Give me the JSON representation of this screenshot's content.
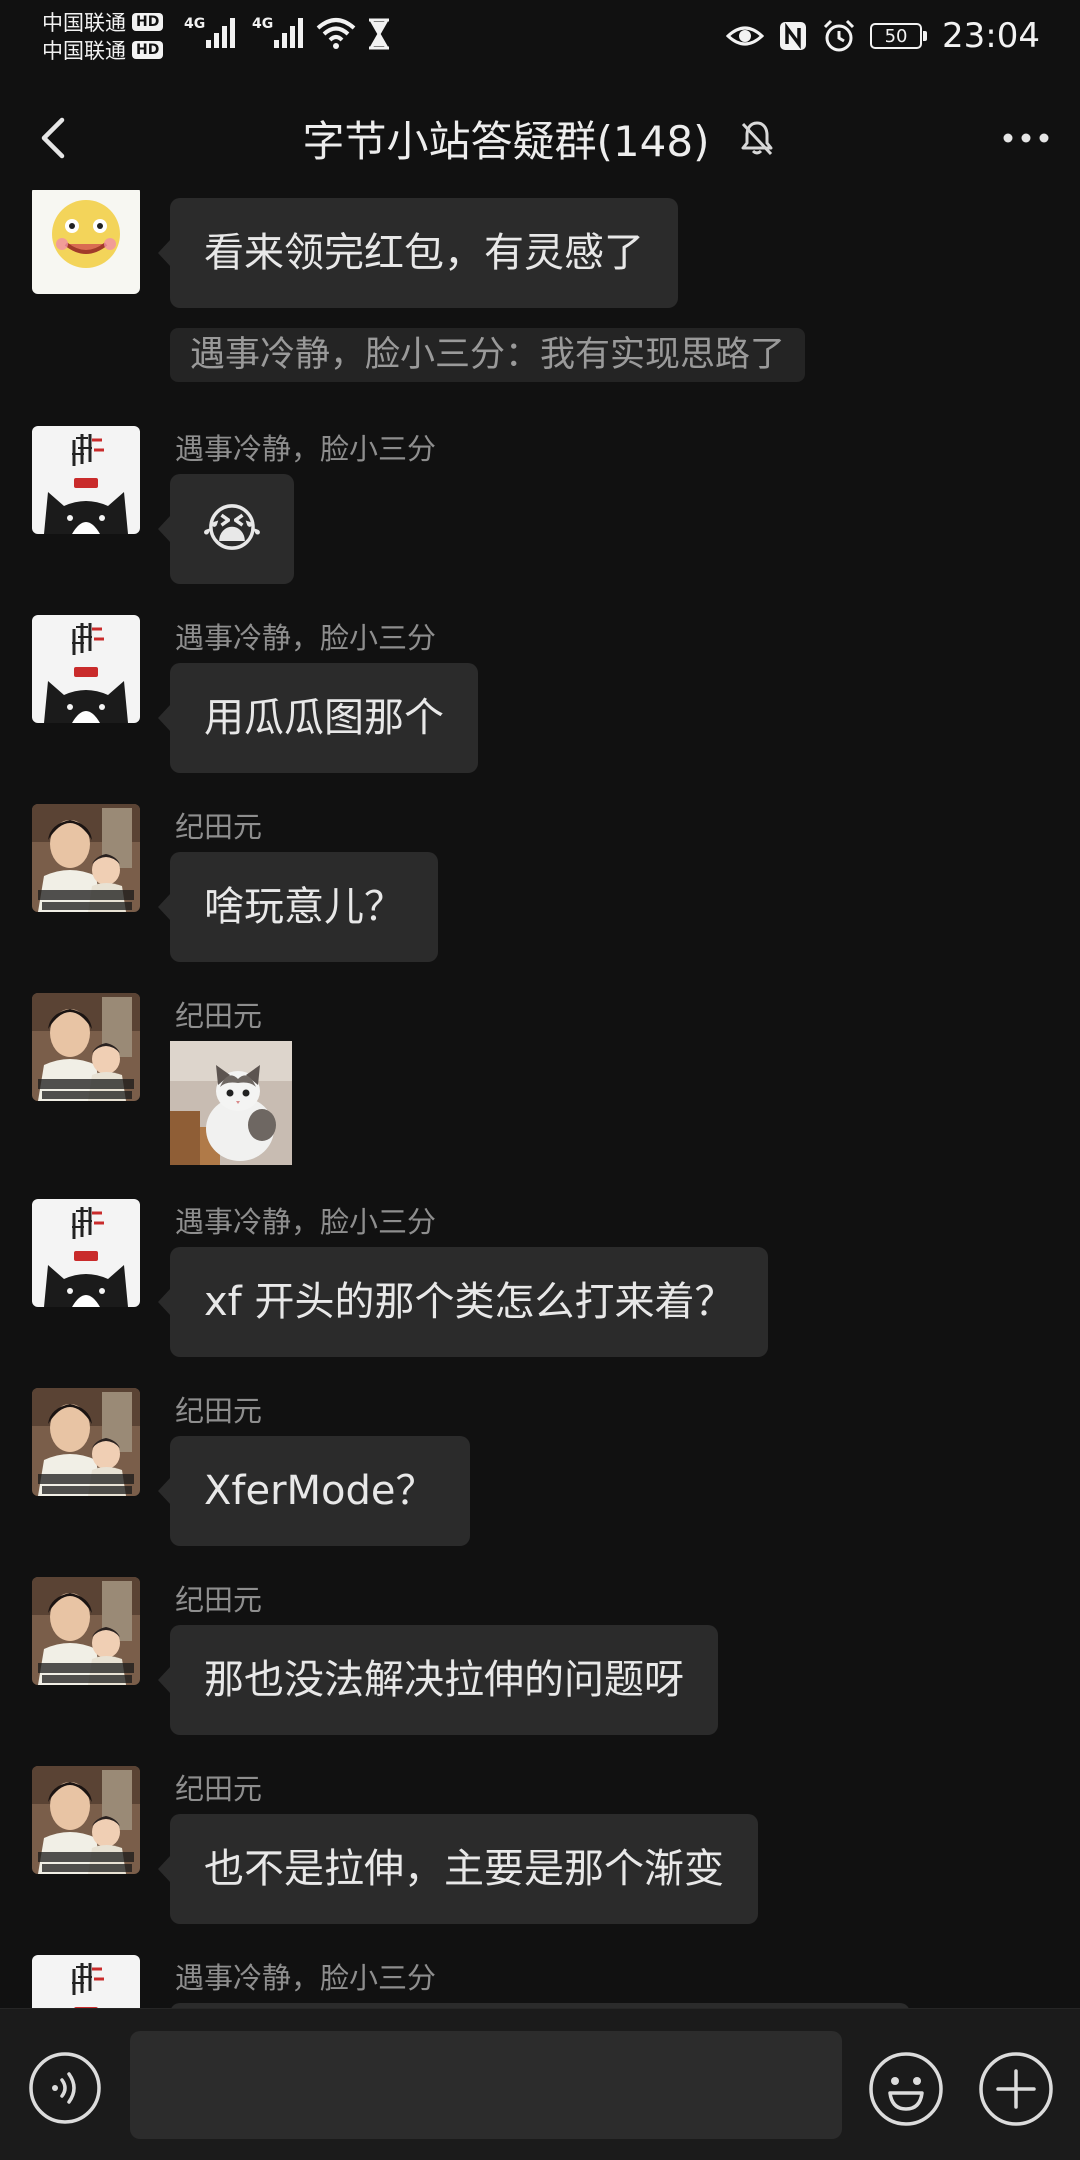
{
  "status_bar": {
    "carrier_1": "中国联通",
    "carrier_2": "中国联通",
    "hd_label": "HD",
    "net_1": "4G",
    "net_2": "4G",
    "battery_level": "50",
    "time": "23:04"
  },
  "header": {
    "title": "字节小站答疑群(148)"
  },
  "messages": [
    {
      "text": "看来领完红包，有灵感了",
      "quote": "遇事冷静，脸小三分：我有实现思路了"
    },
    {
      "sender": "遇事冷静，脸小三分",
      "emoji": "😭"
    },
    {
      "sender": "遇事冷静，脸小三分",
      "text": "用瓜瓜图那个"
    },
    {
      "sender": "纪田元",
      "text": "啥玩意儿？"
    },
    {
      "sender": "纪田元"
    },
    {
      "sender": "遇事冷静，脸小三分",
      "text": "xf 开头的那个类怎么打来着？"
    },
    {
      "sender": "纪田元",
      "text": "XferMode？"
    },
    {
      "sender": "纪田元",
      "text": "那也没法解决拉伸的问题呀"
    },
    {
      "sender": "纪田元",
      "text": "也不是拉伸，主要是那个渐变"
    },
    {
      "sender": "遇事冷静，脸小三分"
    }
  ],
  "input": {
    "value": ""
  },
  "colors": {
    "background": "#111111",
    "bubble": "#2b2b2b",
    "quote": "#242424",
    "sender": "#8e8e8e",
    "input_bar": "#1b1b1b"
  }
}
